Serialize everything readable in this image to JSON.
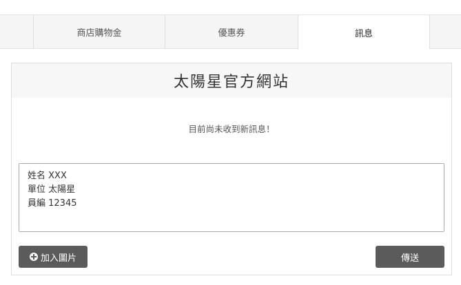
{
  "tabs": [
    {
      "label": ""
    },
    {
      "label": "商店購物金"
    },
    {
      "label": "優惠券"
    },
    {
      "label": "訊息",
      "active": true
    },
    {
      "label": ""
    }
  ],
  "card": {
    "title": "太陽星官方網站",
    "empty_message": "目前尚未收到新訊息！",
    "message_value": "姓名 XXX\n單位 太陽星\n員編 12345",
    "add_image_label": "加入圖片",
    "send_label": "傳送"
  },
  "colors": {
    "button_bg": "#5b5b5b",
    "tab_bar_bg": "#f5f5f5",
    "active_tab_bg": "#ffffff"
  }
}
